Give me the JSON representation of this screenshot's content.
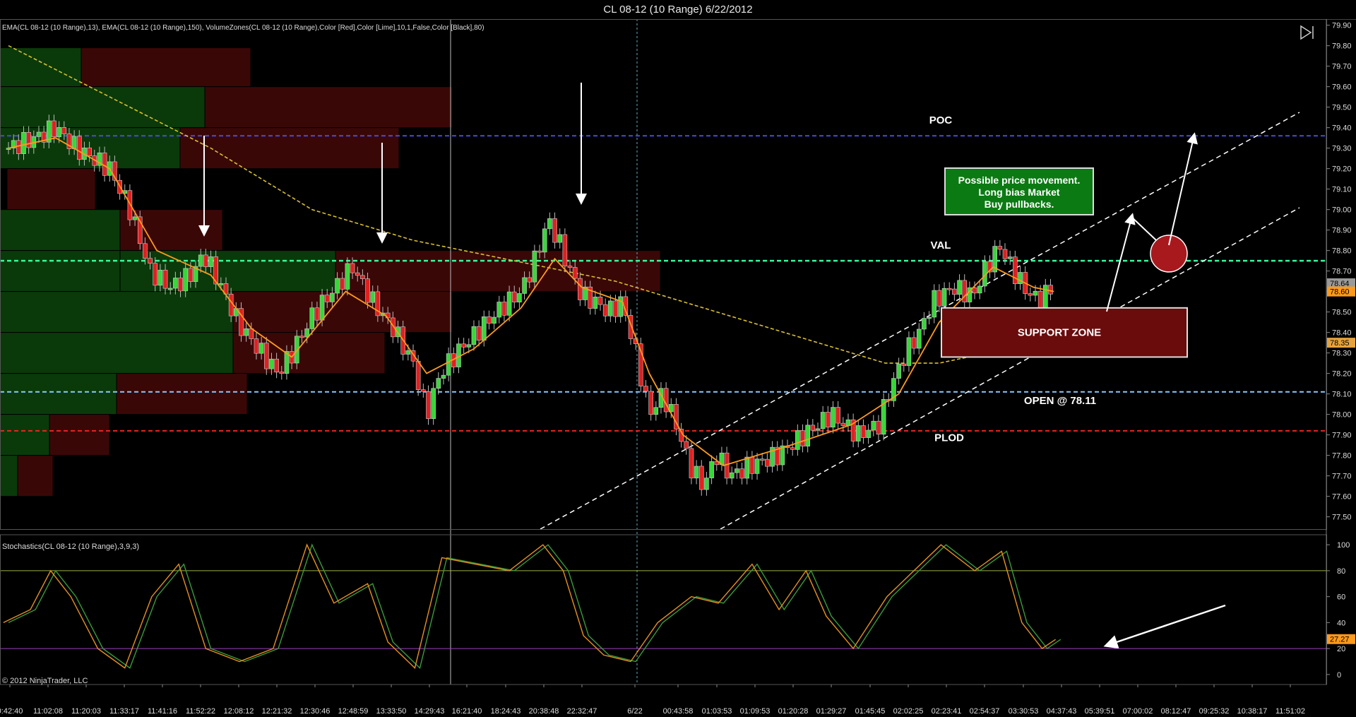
{
  "window": {
    "title": "CL 08-12 (10 Range)  6/22/2012"
  },
  "price_panel": {
    "indicator_label": "EMA(CL 08-12 (10 Range),13), EMA(CL 08-12 (10 Range),150), VolumeZones(CL 08-12 (10 Range),Color [Red],Color [Lime],10,1,False,Color [Black],80)",
    "y_ticks": [
      "79.90",
      "79.80",
      "79.70",
      "79.60",
      "79.50",
      "79.40",
      "79.30",
      "79.20",
      "79.10",
      "79.00",
      "78.90",
      "78.80",
      "78.70",
      "78.60",
      "78.50",
      "78.40",
      "78.30",
      "78.20",
      "78.10",
      "78.00",
      "77.90",
      "77.80",
      "77.70",
      "77.60",
      "77.50"
    ],
    "ylim": [
      77.44,
      79.93
    ],
    "price_badges": [
      {
        "value": "78.64",
        "color": "#9a9a9a"
      },
      {
        "value": "78.60",
        "color": "#ff9a1a"
      },
      {
        "value": "78.35",
        "color": "#e6a33c"
      }
    ]
  },
  "levels": [
    {
      "name": "POC",
      "price": 79.36,
      "color": "#4a4ad8"
    },
    {
      "name": "VAL",
      "price": 78.75,
      "color": "#33ff99"
    },
    {
      "name": "OPEN @ 78.11",
      "price": 78.11,
      "color": "#88c8ff"
    },
    {
      "name": "PLOD",
      "price": 77.92,
      "color": "#ee2222"
    }
  ],
  "annotations": {
    "bias_box": [
      "Possible price movement.",
      "Long bias Market",
      "Buy pullbacks."
    ],
    "support_zone": "SUPPORT ZONE",
    "poc_label": "POC",
    "val_label": "VAL",
    "open_label": "OPEN @ 78.11",
    "plod_label": "PLOD"
  },
  "stoch_panel": {
    "label": "Stochastics(CL 08-12 (10 Range),3,9,3)",
    "y_ticks": [
      "100",
      "80",
      "60",
      "40",
      "20",
      "0"
    ],
    "badge": "27.27",
    "ylim": [
      -5,
      105
    ],
    "levels": [
      80,
      20
    ]
  },
  "x_labels": [
    "0:42:40",
    "11:02:08",
    "11:20:03",
    "11:33:17",
    "11:41:16",
    "11:52:22",
    "12:08:12",
    "12:21:32",
    "12:30:46",
    "12:48:59",
    "13:33:50",
    "14:29:43",
    "16:21:40",
    "18:24:43",
    "20:38:48",
    "22:32:47",
    "6/22",
    "00:43:58",
    "01:03:53",
    "01:09:53",
    "01:20:28",
    "01:29:27",
    "01:45:45",
    "02:02:25",
    "02:23:41",
    "02:54:37",
    "03:30:53",
    "04:37:43",
    "05:39:51",
    "07:00:02",
    "08:12:47",
    "09:25:32",
    "10:38:17",
    "11:51:02"
  ],
  "copyright": "© 2012 NinjaTrader, LLC",
  "chart_data": {
    "type": "candlestick",
    "title": "CL 08-12 (10 Range)  6/22/2012",
    "ylim": [
      77.44,
      79.93
    ],
    "series": [
      {
        "name": "close",
        "points": [
          [
            0,
            79.3
          ],
          [
            8,
            79.35
          ],
          [
            14,
            79.4
          ],
          [
            20,
            79.3
          ],
          [
            30,
            79.2
          ],
          [
            36,
            79.0
          ],
          [
            42,
            78.7
          ],
          [
            48,
            78.62
          ],
          [
            54,
            78.68
          ],
          [
            58,
            78.78
          ],
          [
            62,
            78.66
          ],
          [
            68,
            78.45
          ],
          [
            74,
            78.32
          ],
          [
            80,
            78.2
          ],
          [
            84,
            78.3
          ],
          [
            90,
            78.48
          ],
          [
            96,
            78.6
          ],
          [
            102,
            78.72
          ],
          [
            108,
            78.55
          ],
          [
            114,
            78.42
          ],
          [
            120,
            78.25
          ],
          [
            124,
            78.0
          ],
          [
            128,
            78.2
          ],
          [
            134,
            78.32
          ],
          [
            140,
            78.42
          ],
          [
            146,
            78.52
          ],
          [
            152,
            78.6
          ],
          [
            156,
            78.75
          ],
          [
            160,
            78.95
          ],
          [
            163,
            78.85
          ],
          [
            166,
            78.72
          ],
          [
            170,
            78.58
          ],
          [
            174,
            78.55
          ],
          [
            178,
            78.5
          ],
          [
            182,
            78.55
          ],
          [
            186,
            78.3
          ],
          [
            190,
            78.0
          ],
          [
            194,
            78.1
          ],
          [
            198,
            77.95
          ],
          [
            202,
            77.75
          ],
          [
            206,
            77.65
          ],
          [
            210,
            77.8
          ],
          [
            214,
            77.7
          ],
          [
            220,
            77.75
          ],
          [
            228,
            77.8
          ],
          [
            236,
            77.9
          ],
          [
            244,
            78.0
          ],
          [
            252,
            77.9
          ],
          [
            258,
            77.95
          ],
          [
            262,
            78.15
          ],
          [
            266,
            78.3
          ],
          [
            270,
            78.4
          ],
          [
            274,
            78.55
          ],
          [
            280,
            78.62
          ],
          [
            286,
            78.58
          ],
          [
            290,
            78.72
          ],
          [
            294,
            78.82
          ],
          [
            298,
            78.7
          ],
          [
            302,
            78.6
          ],
          [
            306,
            78.55
          ],
          [
            310,
            78.64
          ]
        ]
      },
      {
        "name": "EMA(13)",
        "points": [
          [
            0,
            79.3
          ],
          [
            14,
            79.35
          ],
          [
            30,
            79.2
          ],
          [
            44,
            78.8
          ],
          [
            60,
            78.68
          ],
          [
            72,
            78.42
          ],
          [
            84,
            78.28
          ],
          [
            100,
            78.6
          ],
          [
            112,
            78.48
          ],
          [
            124,
            78.2
          ],
          [
            138,
            78.32
          ],
          [
            152,
            78.52
          ],
          [
            162,
            78.76
          ],
          [
            170,
            78.62
          ],
          [
            182,
            78.55
          ],
          [
            190,
            78.2
          ],
          [
            200,
            77.9
          ],
          [
            212,
            77.75
          ],
          [
            232,
            77.85
          ],
          [
            250,
            77.95
          ],
          [
            264,
            78.1
          ],
          [
            276,
            78.45
          ],
          [
            292,
            78.72
          ],
          [
            304,
            78.62
          ],
          [
            310,
            78.6
          ]
        ]
      },
      {
        "name": "EMA(150)",
        "points": [
          [
            0,
            79.8
          ],
          [
            30,
            79.55
          ],
          [
            60,
            79.3
          ],
          [
            90,
            79.0
          ],
          [
            120,
            78.85
          ],
          [
            150,
            78.75
          ],
          [
            180,
            78.65
          ],
          [
            210,
            78.5
          ],
          [
            240,
            78.35
          ],
          [
            260,
            78.25
          ],
          [
            276,
            78.25
          ],
          [
            296,
            78.32
          ],
          [
            310,
            78.35
          ]
        ]
      },
      {
        "name": "Stochastics %D",
        "points": [
          [
            0,
            40
          ],
          [
            8,
            50
          ],
          [
            14,
            80
          ],
          [
            20,
            60
          ],
          [
            28,
            20
          ],
          [
            36,
            5
          ],
          [
            44,
            60
          ],
          [
            52,
            85
          ],
          [
            60,
            20
          ],
          [
            70,
            10
          ],
          [
            80,
            20
          ],
          [
            90,
            100
          ],
          [
            98,
            55
          ],
          [
            108,
            70
          ],
          [
            114,
            25
          ],
          [
            122,
            5
          ],
          [
            130,
            90
          ],
          [
            140,
            85
          ],
          [
            150,
            80
          ],
          [
            160,
            100
          ],
          [
            166,
            80
          ],
          [
            172,
            30
          ],
          [
            178,
            15
          ],
          [
            186,
            10
          ],
          [
            194,
            40
          ],
          [
            204,
            60
          ],
          [
            212,
            55
          ],
          [
            222,
            85
          ],
          [
            230,
            50
          ],
          [
            238,
            80
          ],
          [
            244,
            45
          ],
          [
            252,
            20
          ],
          [
            262,
            60
          ],
          [
            270,
            80
          ],
          [
            278,
            100
          ],
          [
            288,
            80
          ],
          [
            296,
            95
          ],
          [
            302,
            40
          ],
          [
            308,
            20
          ],
          [
            312,
            27
          ]
        ]
      }
    ]
  }
}
